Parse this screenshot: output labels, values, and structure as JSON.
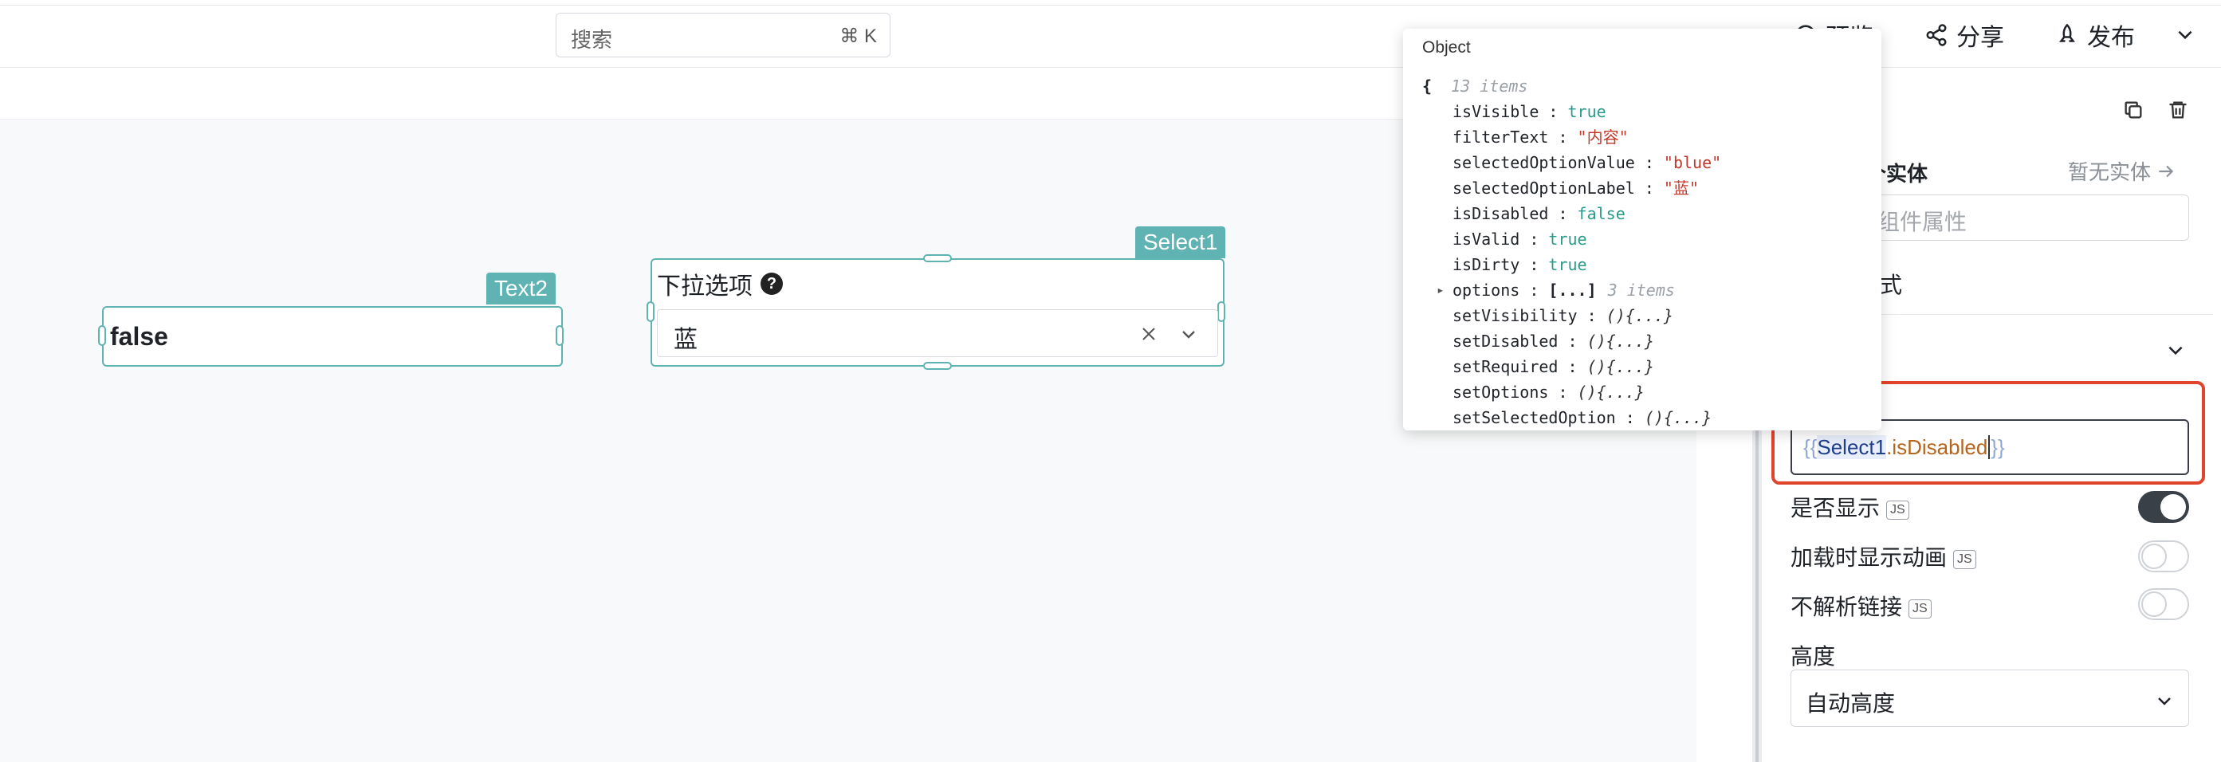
{
  "header": {
    "search_placeholder": "搜索",
    "search_shortcut": "⌘ K",
    "preview_label": "预览",
    "share_label": "分享",
    "publish_label": "发布"
  },
  "canvas": {
    "text_widget": {
      "tag": "Text2",
      "value": "false"
    },
    "select_widget": {
      "tag": "Select1",
      "label": "下拉选项",
      "help": "?",
      "value": "蓝"
    }
  },
  "object_popover": {
    "title": "Object",
    "open_brace": "{",
    "count": "13 items",
    "rows": [
      {
        "key": "isVisible",
        "value": "true",
        "kind": "bool"
      },
      {
        "key": "filterText",
        "value": "\"内容\"",
        "kind": "str"
      },
      {
        "key": "selectedOptionValue",
        "value": "\"blue\"",
        "kind": "str"
      },
      {
        "key": "selectedOptionLabel",
        "value": "\"蓝\"",
        "kind": "str"
      },
      {
        "key": "isDisabled",
        "value": "false",
        "kind": "bool"
      },
      {
        "key": "isValid",
        "value": "true",
        "kind": "bool"
      },
      {
        "key": "isDirty",
        "value": "true",
        "kind": "bool"
      },
      {
        "key": "options",
        "value": "[...]",
        "meta": "3 items",
        "kind": "arr"
      },
      {
        "key": "setVisibility",
        "value": "(){...}",
        "kind": "fn"
      },
      {
        "key": "setDisabled",
        "value": "(){...}",
        "kind": "fn"
      },
      {
        "key": "setRequired",
        "value": "(){...}",
        "kind": "fn"
      },
      {
        "key": "setOptions",
        "value": "(){...}",
        "kind": "fn"
      },
      {
        "key": "setSelectedOption",
        "value": "(){...}",
        "kind": "fn"
      }
    ]
  },
  "panel": {
    "entity_label": "个实体",
    "no_entity": "暂无实体",
    "attr_placeholder": "组件属性",
    "style_label": "样式",
    "code": {
      "open": "{{",
      "ident": "Select1",
      "prop": ".isDisabled",
      "close": "}}"
    },
    "js_badge": "JS",
    "toggles": [
      {
        "label": "是否显示",
        "on": true
      },
      {
        "label": "加载时显示动画",
        "on": false
      },
      {
        "label": "不解析链接",
        "on": false
      }
    ],
    "height_label": "高度",
    "height_value": "自动高度"
  }
}
